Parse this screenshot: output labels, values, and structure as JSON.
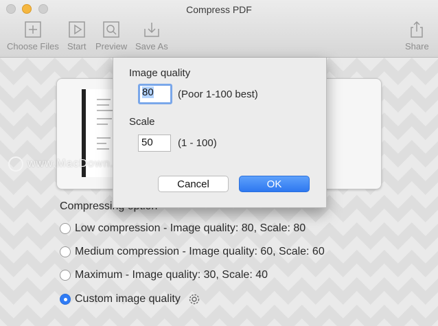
{
  "window": {
    "title": "Compress PDF",
    "toolbar": {
      "choose_files": "Choose Files",
      "start": "Start",
      "preview": "Preview",
      "save_as": "Save As",
      "share": "Share"
    }
  },
  "watermark": "www.MacDown.com",
  "compression": {
    "section_title": "Compressing option",
    "options": [
      {
        "label": "Low compression - Image quality: 80, Scale: 80",
        "selected": false
      },
      {
        "label": "Medium compression - Image quality: 60, Scale: 60",
        "selected": false
      },
      {
        "label": "Maximum - Image quality: 30, Scale: 40",
        "selected": false
      },
      {
        "label": "Custom image quality",
        "selected": true
      }
    ]
  },
  "dialog": {
    "quality_label": "Image quality",
    "quality_value": "80",
    "quality_hint": "(Poor 1-100 best)",
    "scale_label": "Scale",
    "scale_value": "50",
    "scale_hint": "(1 - 100)",
    "cancel": "Cancel",
    "ok": "OK"
  },
  "colors": {
    "accent": "#2f7bf5",
    "toolbar_text": "#8d8d8d"
  }
}
